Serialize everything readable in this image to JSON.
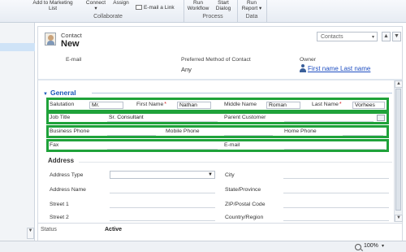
{
  "ribbon": {
    "add_to_marketing": "Add to Marketing\nList",
    "connect": "Connect\n▾",
    "assign": "Assign",
    "email_link": "E-mail a Link",
    "run_workflow": "Run\nWorkflow",
    "start_dialog": "Start\nDialog",
    "run_report": "Run\nReport ▾",
    "groups": {
      "collaborate": "Collaborate",
      "process": "Process",
      "data": "Data"
    }
  },
  "header": {
    "entity": "Contact",
    "title": "New",
    "view_select": "Contacts",
    "fields": [
      {
        "label": "E-mail",
        "value": ""
      },
      {
        "label": "Preferred Method of Contact",
        "value": "Any"
      },
      {
        "label": "Owner",
        "value": "First name Last name"
      }
    ]
  },
  "general": {
    "section_title": "General",
    "salutation": {
      "label": "Salutation",
      "value": "Mr."
    },
    "first_name": {
      "label": "First Name",
      "value": "Nathan"
    },
    "middle_name": {
      "label": "Middle Name",
      "value": "Roman"
    },
    "last_name": {
      "label": "Last Name",
      "value": "Vorhees"
    },
    "job_title": {
      "label": "Job Title",
      "value": "Sr. Consultant"
    },
    "parent_customer": {
      "label": "Parent Customer",
      "value": ""
    },
    "business_phone": {
      "label": "Business Phone",
      "value": ""
    },
    "mobile_phone": {
      "label": "Mobile Phone",
      "value": ""
    },
    "home_phone": {
      "label": "Home Phone",
      "value": ""
    },
    "fax": {
      "label": "Fax",
      "value": ""
    },
    "email": {
      "label": "E-mail",
      "value": ""
    },
    "required_marker": "*"
  },
  "address": {
    "section_title": "Address",
    "left_labels": [
      "Address Type",
      "Address Name",
      "Street 1",
      "Street 2"
    ],
    "right_labels": [
      "City",
      "State/Province",
      "ZIP/Postal Code",
      "Country/Region"
    ]
  },
  "status": {
    "label": "Status",
    "value": "Active"
  },
  "footer": {
    "zoom": "100%"
  },
  "colors": {
    "highlight": "#1fa23a",
    "section_title": "#1a56b8",
    "link": "#1f4fc2",
    "required": "#d02020"
  },
  "icons": [
    "contact-entity-icon",
    "email-icon",
    "owner-user-icon",
    "lookup-icon",
    "zoom-icon"
  ]
}
